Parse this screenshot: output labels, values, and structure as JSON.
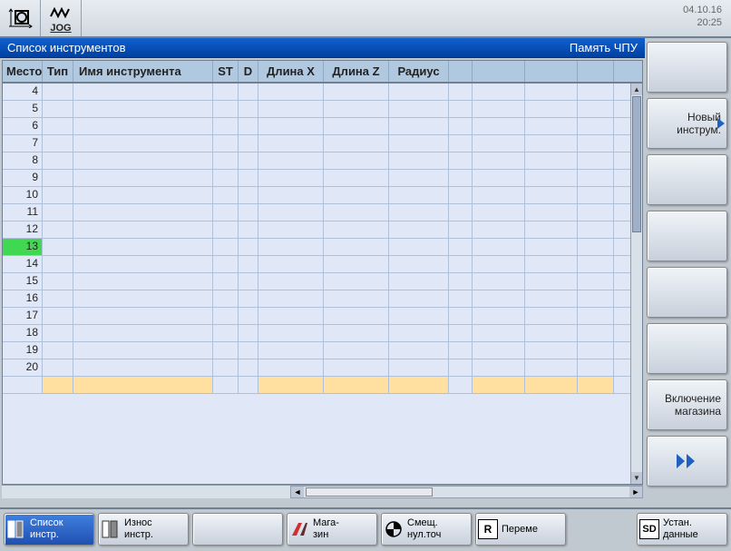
{
  "date": "04.10.16",
  "time": "20:25",
  "jog_label": "JOG",
  "header": {
    "title": "Список инструментов",
    "mode": "Память ЧПУ"
  },
  "columns": {
    "place": "Место",
    "type": "Тип",
    "name": "Имя инструмента",
    "st": "ST",
    "d": "D",
    "lenx": "Длина X",
    "lenz": "Длина Z",
    "radius": "Радиус"
  },
  "rows": [
    4,
    5,
    6,
    7,
    8,
    9,
    10,
    11,
    12,
    13,
    14,
    15,
    16,
    17,
    18,
    19,
    20
  ],
  "selected_row": 13,
  "right_keys": [
    {
      "id": "rk0",
      "label": ""
    },
    {
      "id": "rk-new",
      "label": "Новый\nинструм."
    },
    {
      "id": "rk2",
      "label": ""
    },
    {
      "id": "rk3",
      "label": ""
    },
    {
      "id": "rk4",
      "label": ""
    },
    {
      "id": "rk5",
      "label": ""
    },
    {
      "id": "rk-mag",
      "label": "Включение\nмагазина"
    },
    {
      "id": "rk-next",
      "label": ""
    }
  ],
  "bottom_keys": {
    "list": "Список\nинстр.",
    "wear": "Износ\nинстр.",
    "mag": "Мага-\nзин",
    "offset": "Смещ.\nнул.точ",
    "move": "Переме",
    "setup": "Устан.\nданные"
  },
  "icons": {
    "sd": "SD",
    "r": "R"
  }
}
